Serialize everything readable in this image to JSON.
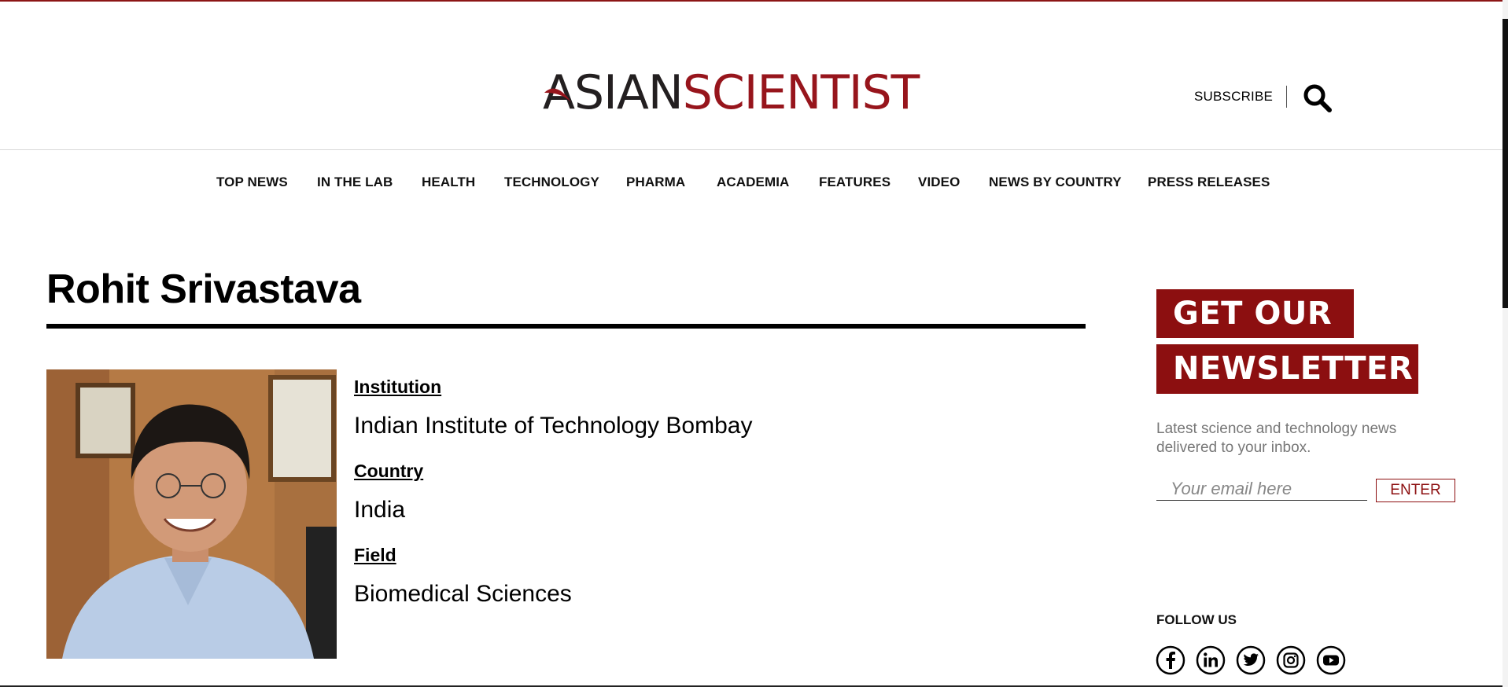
{
  "header": {
    "logo_word1": "ASIAN",
    "logo_word2": "SCIENTIST",
    "subscribe_label": "SUBSCRIBE",
    "search_icon": "search-icon"
  },
  "nav": {
    "items": [
      {
        "label": "TOP NEWS"
      },
      {
        "label": "IN THE LAB"
      },
      {
        "label": "HEALTH"
      },
      {
        "label": "TECHNOLOGY"
      },
      {
        "label": "PHARMA"
      },
      {
        "label": "ACADEMIA"
      },
      {
        "label": "FEATURES"
      },
      {
        "label": "VIDEO"
      },
      {
        "label": "NEWS BY COUNTRY"
      },
      {
        "label": "PRESS RELEASES"
      }
    ]
  },
  "profile": {
    "name": "Rohit Srivastava",
    "fields": [
      {
        "label": "Institution",
        "value": "Indian Institute of Technology Bombay"
      },
      {
        "label": "Country",
        "value": "India"
      },
      {
        "label": "Field",
        "value": "Biomedical Sciences"
      }
    ]
  },
  "newsletter": {
    "line1": "GET OUR",
    "line2": "NEWSLETTER",
    "subtitle": "Latest science and technology news delivered to your inbox.",
    "email_placeholder": "Your email here",
    "enter_label": "ENTER"
  },
  "follow": {
    "label": "FOLLOW US",
    "icons": [
      "facebook-icon",
      "linkedin-icon",
      "twitter-icon",
      "instagram-icon",
      "youtube-icon"
    ]
  },
  "colors": {
    "brand_red": "#8c0f10",
    "logo_red": "#97151c",
    "logo_dark": "#231f20"
  }
}
